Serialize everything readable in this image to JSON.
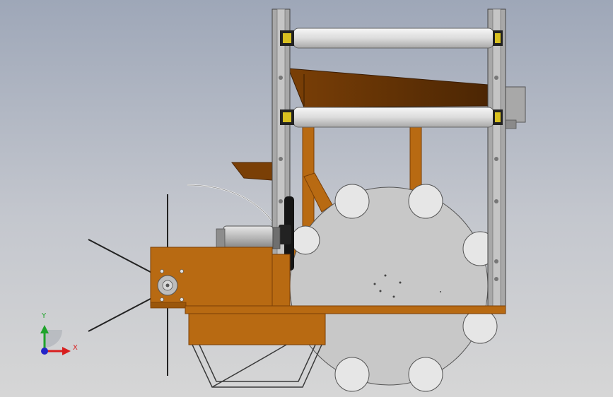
{
  "view": {
    "background_top": "#9ea7b8",
    "background_bottom": "#d6d6d6"
  },
  "colors": {
    "wood": "#b86a12",
    "wood_dark": "#7a3f06",
    "chute": "#5a2e08",
    "roller": "#e8e8e8",
    "rail": "#a8a8a8",
    "disc": "#c8c8c8",
    "axis_x": "#d81e1e",
    "axis_y": "#1fa32b",
    "axis_z": "#2424c8"
  },
  "triad": {
    "y_label": "Y",
    "x_label": "X",
    "icon": "coordinate-triad-icon"
  }
}
